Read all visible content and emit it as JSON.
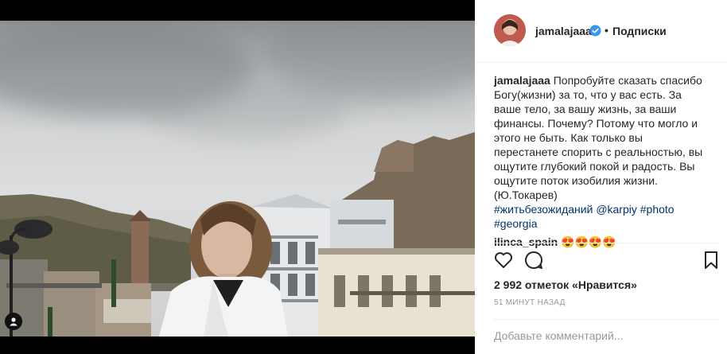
{
  "post": {
    "username": "jamalajaaa",
    "follow_separator": "•",
    "follow_label": "Подписки",
    "caption_text": "Попробуйте сказать спасибо Богу(жизни) за то, что у вас есть. За ваше тело, за вашу жизнь, за ваши финансы. Почему? Потому что могло и этого не быть. Как только вы перестанете спорить с реальностью, вы ощутите глубокий покой и радость. Вы ощутите поток изобилия жизни. (Ю.Токарев)",
    "caption_tags": [
      "#житьбезожиданий",
      "@karpiy",
      "#photo",
      "#georgia"
    ],
    "comments": [
      {
        "username": "ilinca_spain",
        "text": "😍😍😍😍"
      }
    ],
    "likes_label": "2 992 отметок «Нравится»",
    "timestamp": "51 МИНУТ НАЗАД",
    "add_comment_placeholder": "Добавьте комментарий..."
  },
  "icons": {
    "verified": "verified-badge-icon",
    "like": "heart-icon",
    "comment": "comment-bubble-icon",
    "save": "bookmark-icon",
    "tagged": "person-tag-icon"
  },
  "colors": {
    "text": "#262626",
    "muted": "#999999",
    "link": "#003569",
    "verified": "#3897f0",
    "divider": "#efefef"
  }
}
